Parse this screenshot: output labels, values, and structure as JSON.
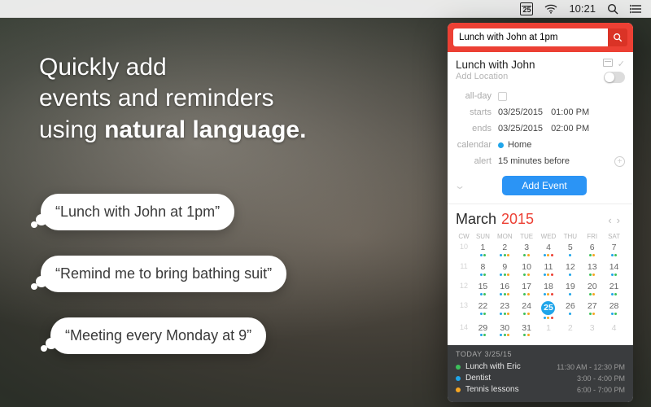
{
  "menubar": {
    "date_icon_day": "25",
    "time": "10:21"
  },
  "headline": {
    "line1": "Quickly add",
    "line2": "events and reminders",
    "line3_pre": "using ",
    "line3_bold": "natural language."
  },
  "bubbles": {
    "b1": "“Lunch with John at 1pm”",
    "b2": "“Remind me to bring bathing suit”",
    "b3": "“Meeting every Monday at 9”"
  },
  "panel": {
    "query": "Lunch with John at 1pm",
    "event": {
      "title": "Lunch with John",
      "location_placeholder": "Add Location",
      "allday_label": "all-day",
      "starts_label": "starts",
      "starts_date": "03/25/2015",
      "starts_time": "01:00 PM",
      "ends_label": "ends",
      "ends_date": "03/25/2015",
      "ends_time": "02:00 PM",
      "calendar_label": "calendar",
      "calendar_value": "Home",
      "alert_label": "alert",
      "alert_value": "15 minutes before",
      "add_button": "Add Event"
    },
    "calendar": {
      "month": "March",
      "year": "2015",
      "cw_header": "CW",
      "dow": [
        "SUN",
        "MON",
        "TUE",
        "WED",
        "THU",
        "FRI",
        "SAT"
      ],
      "weeks": [
        {
          "cw": "10",
          "days": [
            "1",
            "2",
            "3",
            "4",
            "5",
            "6",
            "7"
          ]
        },
        {
          "cw": "11",
          "days": [
            "8",
            "9",
            "10",
            "11",
            "12",
            "13",
            "14"
          ]
        },
        {
          "cw": "12",
          "days": [
            "15",
            "16",
            "17",
            "18",
            "19",
            "20",
            "21"
          ]
        },
        {
          "cw": "13",
          "days": [
            "22",
            "23",
            "24",
            "25",
            "26",
            "27",
            "28"
          ]
        },
        {
          "cw": "14",
          "days": [
            "29",
            "30",
            "31",
            "1",
            "2",
            "3",
            "4"
          ]
        }
      ],
      "today_index": [
        3,
        3
      ]
    },
    "today": {
      "header": "TODAY 3/25/15",
      "items": [
        {
          "dot": "#3cc05b",
          "title": "Lunch with Eric",
          "time": "11:30 AM - 12:30 PM"
        },
        {
          "dot": "#1fa5ea",
          "title": "Dentist",
          "time": "3:00 - 4:00 PM"
        },
        {
          "dot": "#f5a623",
          "title": "Tennis lessons",
          "time": "6:00 - 7:00 PM"
        }
      ]
    }
  }
}
